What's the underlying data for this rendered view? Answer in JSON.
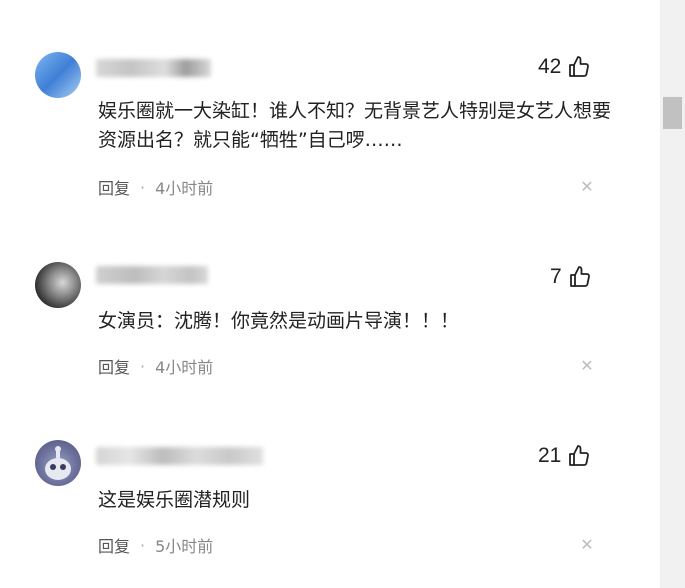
{
  "comments": [
    {
      "likes": "42",
      "text": "娱乐圈就一大染缸！谁人不知？无背景艺人特别是女艺人想要资源出名？就只能“牺牲”自己啰……",
      "reply_label": "回复",
      "separator": "·",
      "time": "4小时前",
      "avatar_icon": "avatar-image",
      "close_icon": "close-icon"
    },
    {
      "likes": "7",
      "text": "女演员：沈腾！你竟然是动画片导演！！！",
      "reply_label": "回复",
      "separator": "·",
      "time": "4小时前",
      "avatar_icon": "avatar-image",
      "close_icon": "close-icon"
    },
    {
      "likes": "21",
      "text": "这是娱乐圈潜规则",
      "reply_label": "回复",
      "separator": "·",
      "time": "5小时前",
      "avatar_icon": "avatar-image",
      "close_icon": "close-icon"
    }
  ],
  "colors": {
    "text": "#222222",
    "meta": "#888888",
    "scrollbar_track": "#f1f1f1",
    "scrollbar_thumb": "#c1c1c1"
  }
}
